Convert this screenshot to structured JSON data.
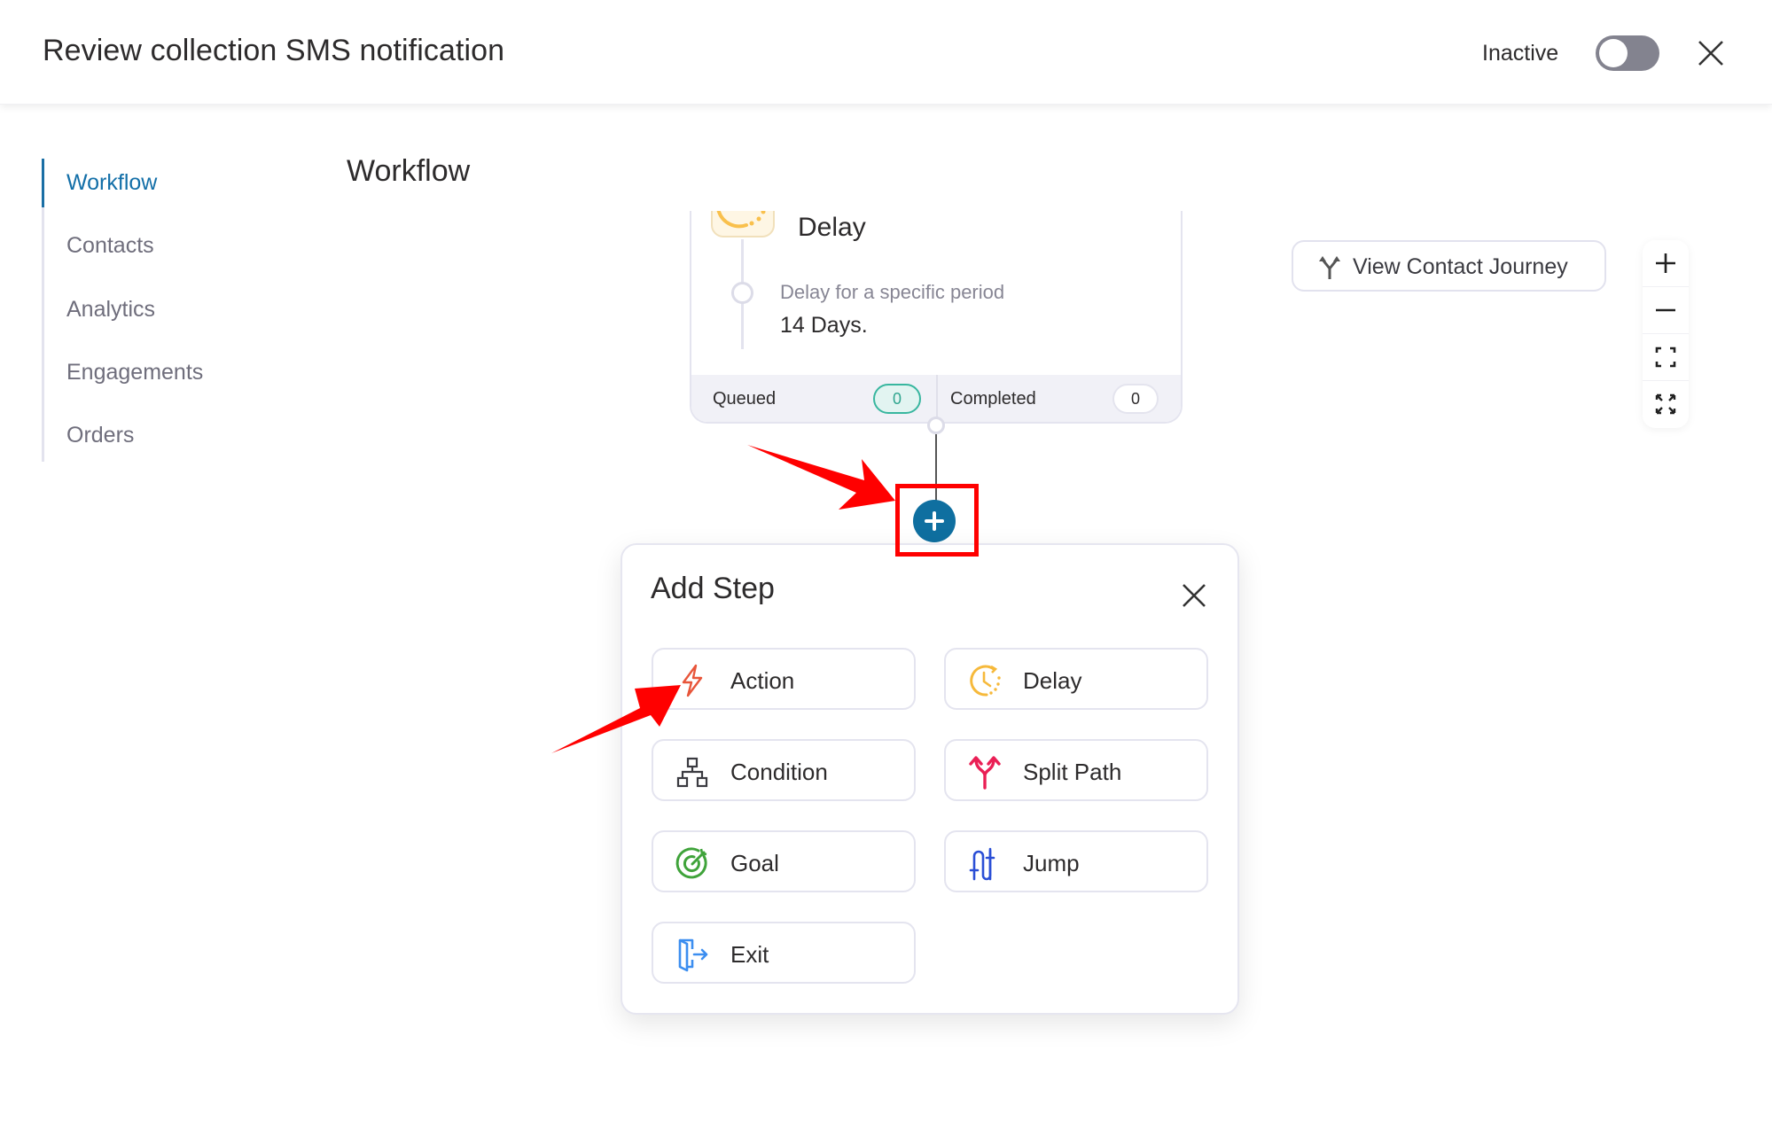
{
  "header": {
    "title": "Review collection SMS notification",
    "status_label": "Inactive",
    "toggle_on": false,
    "close_icon": "close-icon"
  },
  "sidebar": {
    "items": [
      {
        "label": "Workflow",
        "active": true
      },
      {
        "label": "Contacts",
        "active": false
      },
      {
        "label": "Analytics",
        "active": false
      },
      {
        "label": "Engagements",
        "active": false
      },
      {
        "label": "Orders",
        "active": false
      }
    ]
  },
  "main": {
    "heading": "Workflow",
    "delay_card": {
      "icon": "clock-icon",
      "title": "Delay",
      "description": "Delay for a specific period",
      "value": "14 Days.",
      "footer": {
        "queued_label": "Queued",
        "queued_count": "0",
        "completed_label": "Completed",
        "completed_count": "0"
      }
    },
    "add_step_icon": "plus-icon",
    "journey_button": {
      "icon": "split-arrows-icon",
      "label": "View Contact Journey"
    },
    "zoom_controls": [
      {
        "icon": "zoom-in-icon",
        "label": "+"
      },
      {
        "icon": "zoom-out-icon",
        "label": "−"
      },
      {
        "icon": "fit-view-icon",
        "label": ""
      },
      {
        "icon": "fullscreen-icon",
        "label": ""
      }
    ]
  },
  "popup": {
    "title": "Add Step",
    "close_icon": "close-icon",
    "options": [
      {
        "label": "Action",
        "icon": "lightning-icon",
        "color": "#e8553a"
      },
      {
        "label": "Delay",
        "icon": "clock-icon",
        "color": "#f6b93b"
      },
      {
        "label": "Condition",
        "icon": "hierarchy-icon",
        "color": "#3a3a40"
      },
      {
        "label": "Split Path",
        "icon": "split-path-icon",
        "color": "#ea1f55"
      },
      {
        "label": "Goal",
        "icon": "target-icon",
        "color": "#3fa33a"
      },
      {
        "label": "Jump",
        "icon": "jump-icon",
        "color": "#2b4fd6"
      },
      {
        "label": "Exit",
        "icon": "exit-door-icon",
        "color": "#3c8ef0"
      }
    ]
  },
  "colors": {
    "accent": "#136fa8",
    "add_button": "#0f6fa0",
    "annotation": "#ff0000",
    "queued_badge": "#38b69f"
  }
}
